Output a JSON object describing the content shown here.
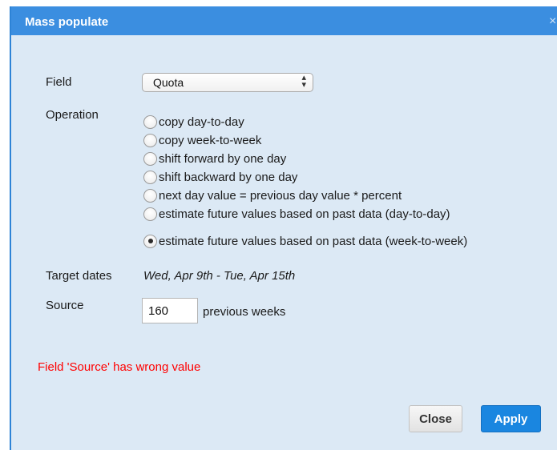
{
  "dialog": {
    "title": "Mass populate",
    "close_glyph": "×",
    "accent_color": "#3b8ee0",
    "body_color": "#dce9f5"
  },
  "field": {
    "label": "Field",
    "selected": "Quota",
    "arrows": "⬍"
  },
  "operation": {
    "label": "Operation",
    "options": [
      {
        "label": "copy day-to-day",
        "checked": false
      },
      {
        "label": "copy week-to-week",
        "checked": false
      },
      {
        "label": "shift forward by one day",
        "checked": false
      },
      {
        "label": "shift backward by one day",
        "checked": false
      },
      {
        "label": "next day value = previous day value * percent",
        "checked": false
      },
      {
        "label": "estimate future values based on past data (day-to-day)",
        "checked": false
      },
      {
        "label": "estimate future values based on past data (week-to-week)",
        "checked": true
      }
    ]
  },
  "target_dates": {
    "label": "Target dates",
    "value": "Wed, Apr 9th - Tue, Apr 15th"
  },
  "source": {
    "label": "Source",
    "value": "160",
    "suffix": "previous weeks"
  },
  "error": {
    "text": "Field 'Source' has wrong value",
    "color": "#ff0000"
  },
  "buttons": {
    "close_label": "Close",
    "apply_label": "Apply"
  }
}
